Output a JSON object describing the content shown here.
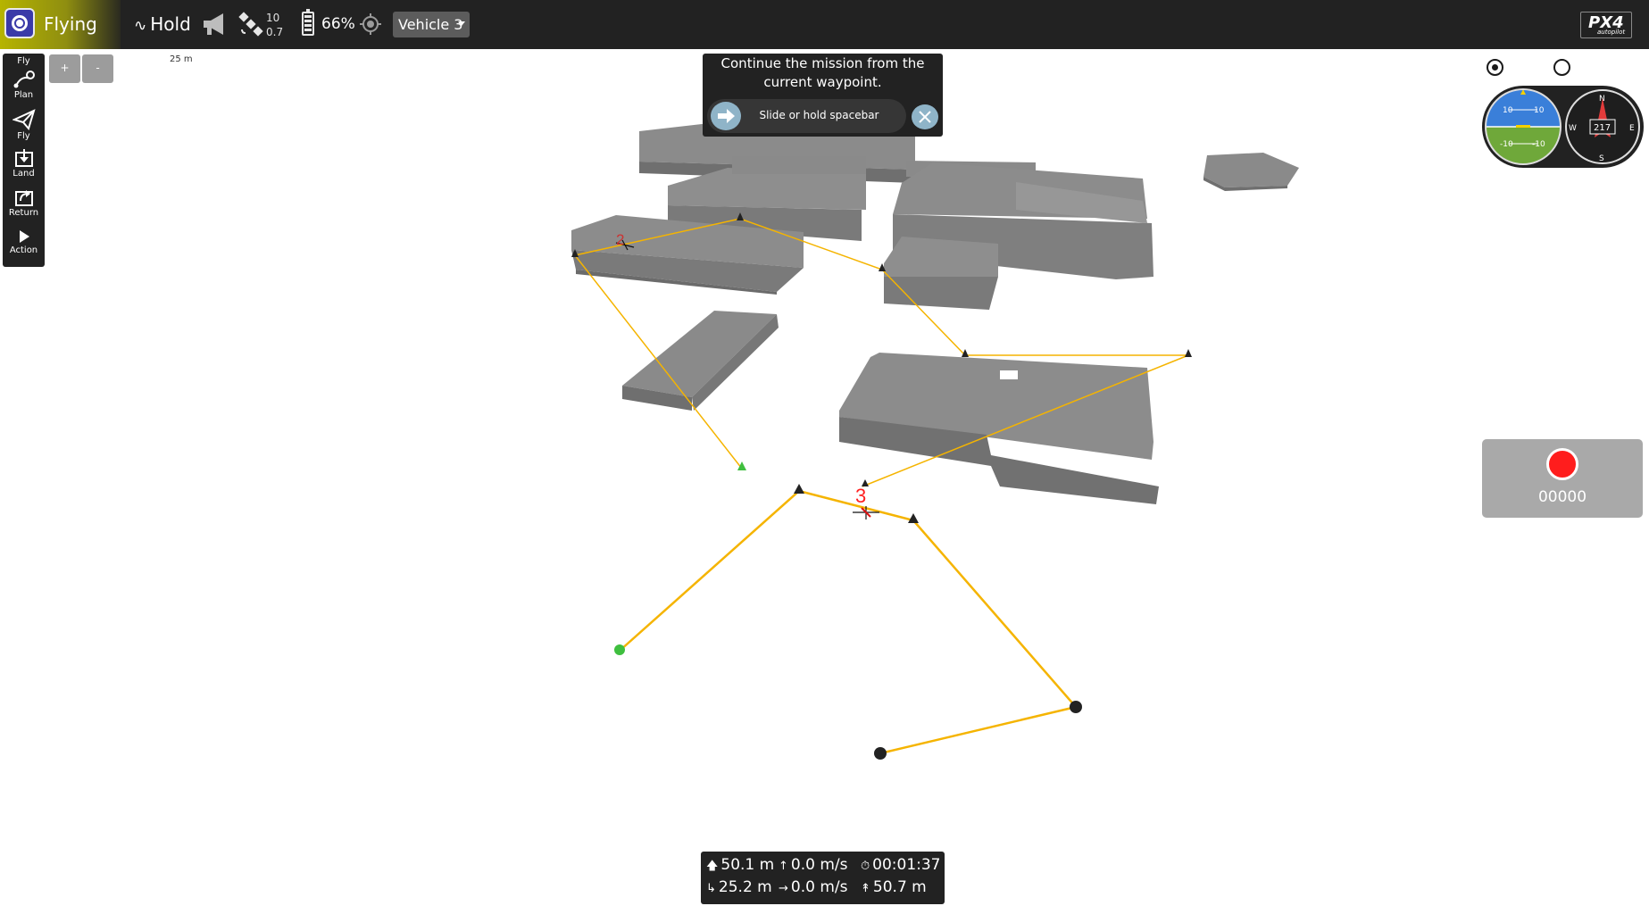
{
  "topbar": {
    "flight_status": "Flying",
    "flight_mode": "Hold",
    "gps_count": "10",
    "gps_hdop": "0.7",
    "battery": "66%",
    "vehicle_select": "Vehicle 3",
    "brand": "PX4",
    "brand_sub": "autopilot"
  },
  "toolstrip": {
    "header": "Fly",
    "items": [
      {
        "label": "Plan",
        "icon": "plan-icon"
      },
      {
        "label": "Fly",
        "icon": "paper-plane-icon"
      },
      {
        "label": "Land",
        "icon": "land-icon"
      },
      {
        "label": "Return",
        "icon": "return-icon"
      },
      {
        "label": "Action",
        "icon": "play-icon"
      }
    ]
  },
  "map": {
    "zoom_in": "+",
    "zoom_out": "-",
    "scale": "25 m",
    "waypoint_labels": [
      "2",
      "3"
    ]
  },
  "confirm": {
    "message": "Continue the mission from the current waypoint.",
    "slider_label": "Slide or hold spacebar"
  },
  "instruments": {
    "heading": "217",
    "pitch_up": "10",
    "pitch_down": "-10",
    "compass": [
      "N",
      "E",
      "S",
      "W"
    ]
  },
  "record": {
    "counter": "00000"
  },
  "values": {
    "altitude": "50.1 m",
    "vertical_speed": "0.0 m/s",
    "flight_time": "00:01:37",
    "distance": "25.2 m",
    "horizontal_speed": "0.0 m/s",
    "distance_to_home": "50.7 m"
  },
  "colors": {
    "toolbar": "#222222",
    "flying_accent": "#b6b400",
    "mission_line": "#f5b400",
    "building": "#8a8a8a",
    "record": "#ff1d1d"
  }
}
